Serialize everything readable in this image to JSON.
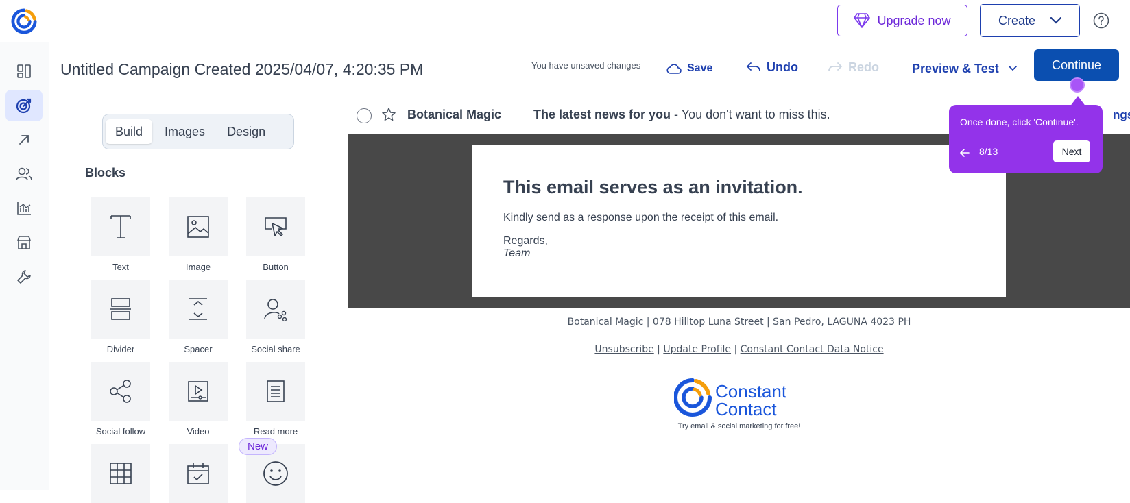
{
  "topbar": {
    "upgrade_label": "Upgrade now",
    "create_label": "Create"
  },
  "header": {
    "campaign_title": "Untitled Campaign Created 2025/04/07, 4:20:35 PM",
    "unsaved_text": "You have unsaved changes",
    "save_label": "Save",
    "undo_label": "Undo",
    "redo_label": "Redo",
    "preview_label": "Preview & Test",
    "continue_label": "Continue"
  },
  "sidebar": {
    "items": [
      {
        "name": "dashboard-icon"
      },
      {
        "name": "campaigns-icon",
        "active": true
      },
      {
        "name": "arrow-up-right-icon"
      },
      {
        "name": "contacts-icon"
      },
      {
        "name": "reporting-icon"
      },
      {
        "name": "store-icon"
      },
      {
        "name": "tools-icon"
      }
    ]
  },
  "editor": {
    "tabs": [
      "Build",
      "Images",
      "Design"
    ],
    "active_tab": "Build",
    "blocks_heading": "Blocks",
    "blocks": [
      {
        "label": "Text",
        "icon": "text-icon"
      },
      {
        "label": "Image",
        "icon": "image-icon"
      },
      {
        "label": "Button",
        "icon": "button-icon"
      },
      {
        "label": "Divider",
        "icon": "divider-icon"
      },
      {
        "label": "Spacer",
        "icon": "spacer-icon"
      },
      {
        "label": "Social share",
        "icon": "social-share-icon"
      },
      {
        "label": "Social follow",
        "icon": "social-follow-icon"
      },
      {
        "label": "Video",
        "icon": "video-icon"
      },
      {
        "label": "Read more",
        "icon": "read-more-icon"
      },
      {
        "label": "",
        "icon": "table-icon"
      },
      {
        "label": "",
        "icon": "calendar-icon"
      },
      {
        "label": "",
        "icon": "emoji-icon"
      }
    ],
    "new_badge": "New"
  },
  "inbox_preview": {
    "sender": "Botanical Magic",
    "subject": "The latest news for you",
    "preheader": " - You don't want to miss this.",
    "settings_partial": "ngs"
  },
  "email": {
    "heading": "This email serves as an invitation.",
    "body": "Kindly send as a response upon the receipt of this email.",
    "regards": "Regards,",
    "signature": "Team",
    "footer_address": "Botanical Magic | 078 Hilltop Luna Street | San Pedro, LAGUNA 4023 PH",
    "footer_links": [
      "Unsubscribe",
      "Update Profile",
      "Constant Contact Data Notice"
    ],
    "brand_line1": "Constant",
    "brand_line2": "Contact",
    "brand_tagline": "Try email & social marketing for free!"
  },
  "tour": {
    "message": "Once done, click 'Continue'.",
    "step": "8/13",
    "next_label": "Next"
  },
  "colors": {
    "primary": "#0b4fb0",
    "accent_purple": "#9333ea",
    "canvas_dark": "#484848"
  }
}
